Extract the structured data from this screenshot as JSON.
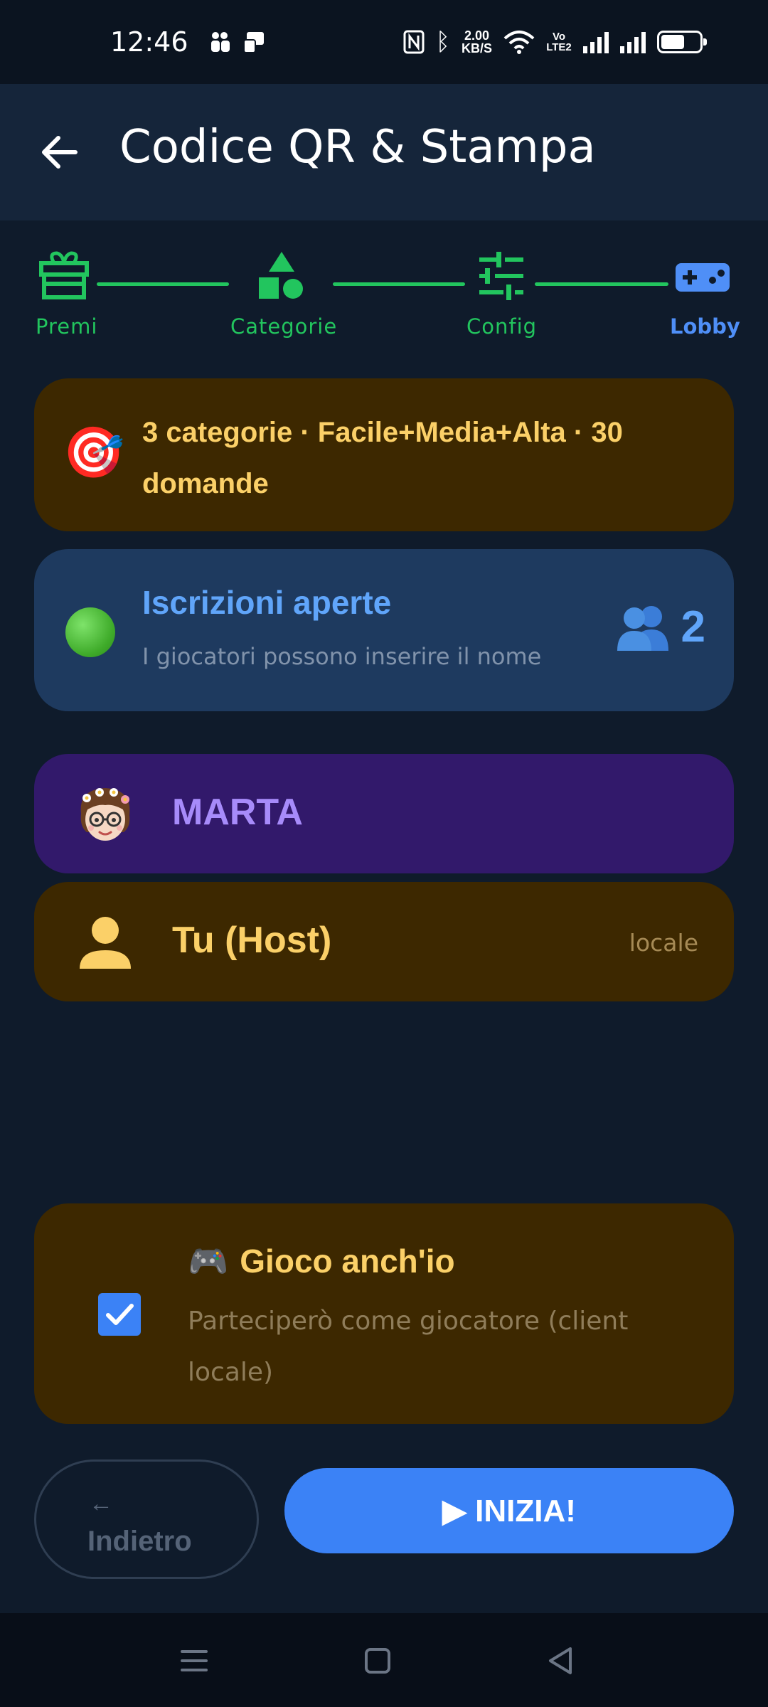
{
  "status_bar": {
    "time": "12:46",
    "net_speed_value": "2.00",
    "net_speed_unit": "KB/S",
    "volte": "Vo LTE2",
    "battery_level": 0.62
  },
  "app_bar": {
    "title": "Codice QR & Stampa"
  },
  "stepper": {
    "steps": [
      {
        "label": "Premi",
        "icon": "gift-icon",
        "state": "done"
      },
      {
        "label": "Categorie",
        "icon": "shapes-icon",
        "state": "done"
      },
      {
        "label": "Config",
        "icon": "sliders-icon",
        "state": "done"
      },
      {
        "label": "Lobby",
        "icon": "gamepad-icon",
        "state": "active"
      }
    ],
    "done_color": "#22c55e",
    "active_color": "#4f8ff7"
  },
  "summary": {
    "emoji": "🎯",
    "text": "3 categorie · Facile+Media+Alta · 30 domande"
  },
  "registration": {
    "title": "Iscrizioni aperte",
    "subtitle": "I giocatori possono inserire il nome",
    "count": "2"
  },
  "players": [
    {
      "name": "MARTA",
      "tag": ""
    },
    {
      "name": "Tu (Host)",
      "tag": "locale"
    }
  ],
  "play_option": {
    "emoji": "🎮",
    "title": "Gioco anch'io",
    "subtitle": "Parteciperò come giocatore (client locale)",
    "checked": true
  },
  "actions": {
    "back_arrow": "←",
    "back_label": "Indietro",
    "start_label": "▶ INIZIA!"
  },
  "colors": {
    "background": "#0f1b2b",
    "accent_blue": "#3b82f6",
    "gold": "#fbd068",
    "purple": "#a78bfa"
  }
}
